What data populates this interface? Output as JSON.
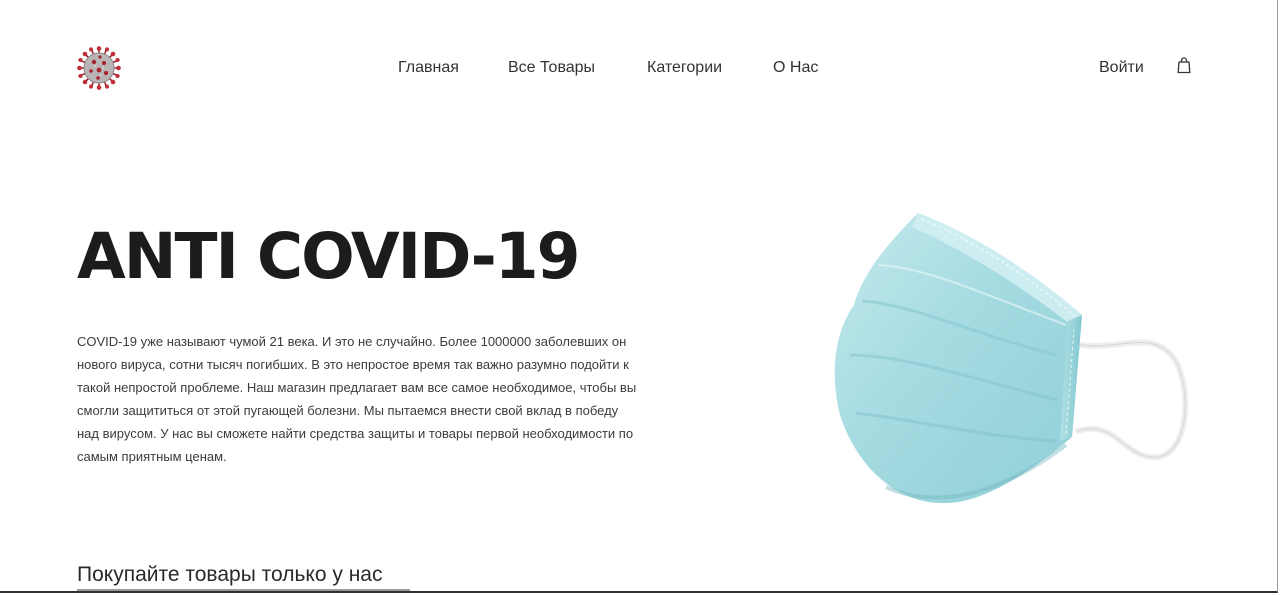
{
  "header": {
    "logo_icon": "coronavirus-logo-icon",
    "nav": {
      "home": "Главная",
      "all_products": "Все Товары",
      "categories": "Категории",
      "about": "О Нас"
    },
    "login": "Войти",
    "cart_icon": "shopping-bag-icon"
  },
  "hero": {
    "title": "ANTI COVID-19",
    "description": "COVID-19 уже называют чумой 21 века. И это не случайно. Более 1000000 заболевших он нового вируса, сотни тысяч погибших. В это непростое время так важно разумно подойти к такой непростой проблеме. Наш магазин предлагает вам все самое необходимое, чтобы вы смогли защититься от этой пугающей болезни. Мы пытаемся внести свой вклад в победу над вирусом. У нас вы сможете найти средства защиты и товары первой необходимости по самым приятным ценам.",
    "image_icon": "medical-mask-image"
  },
  "section": {
    "heading": "Покупайте товары только у нас"
  },
  "colors": {
    "text": "#222222",
    "mask": "#a9dde2",
    "virus": "#b3262e"
  }
}
